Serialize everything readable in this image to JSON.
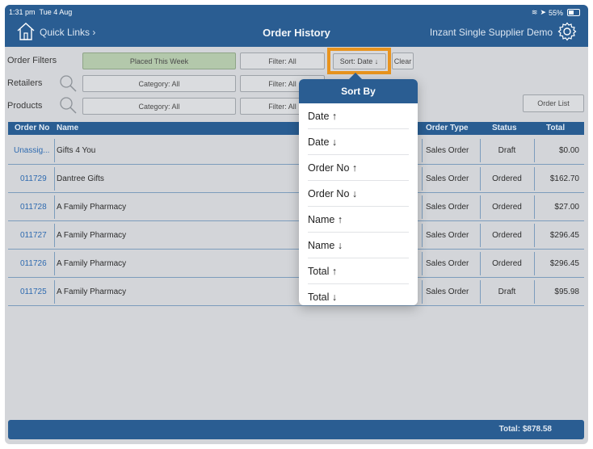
{
  "status": {
    "time": "1:31 pm",
    "date": "Tue 4 Aug",
    "battery": "55%"
  },
  "header": {
    "quick_links": "Quick Links ›",
    "title": "Order History",
    "supplier": "Inzant Single Supplier Demo"
  },
  "filters": {
    "order_filters_label": "Order Filters",
    "retailers_label": "Retailers",
    "products_label": "Products",
    "placed": "Placed This Week",
    "filter_all": "Filter: All",
    "sort": "Sort: Date ↓",
    "clear": "Clear",
    "category_all": "Category: All",
    "order_list": "Order List"
  },
  "table": {
    "headers": {
      "order_no": "Order No",
      "name": "Name",
      "order_type": "Order Type",
      "status": "Status",
      "total": "Total"
    },
    "rows": [
      {
        "order_no": "Unassig...",
        "name": "Gifts 4 You",
        "type": "Sales Order",
        "status": "Draft",
        "total": "$0.00"
      },
      {
        "order_no": "011729",
        "name": "Dantree Gifts",
        "type": "Sales Order",
        "status": "Ordered",
        "total": "$162.70"
      },
      {
        "order_no": "011728",
        "name": "A Family Pharmacy",
        "type": "Sales Order",
        "status": "Ordered",
        "total": "$27.00"
      },
      {
        "order_no": "011727",
        "name": "A Family Pharmacy",
        "type": "Sales Order",
        "status": "Ordered",
        "total": "$296.45"
      },
      {
        "order_no": "011726",
        "name": "A Family Pharmacy",
        "type": "Sales Order",
        "status": "Ordered",
        "total": "$296.45"
      },
      {
        "order_no": "011725",
        "name": "A Family Pharmacy",
        "type": "Sales Order",
        "status": "Draft",
        "total": "$95.98"
      }
    ]
  },
  "footer": {
    "total": "Total: $878.58"
  },
  "sort_popover": {
    "title": "Sort By",
    "options": [
      "Date ↑",
      "Date ↓",
      "Order No ↑",
      "Order No ↓",
      "Name ↑",
      "Name ↓",
      "Total ↑",
      "Total ↓"
    ]
  },
  "colors": {
    "header_blue": "#2a5d92",
    "accent_orange": "#e8941f",
    "filter_green": "#b3c8ab"
  }
}
